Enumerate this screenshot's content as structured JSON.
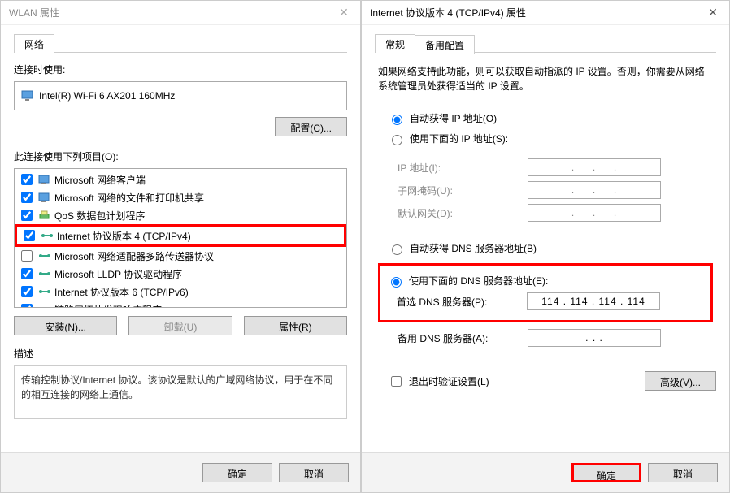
{
  "wlan": {
    "title": "WLAN 属性",
    "tab_network": "网络",
    "connect_using_label": "连接时使用:",
    "adapter": "Intel(R) Wi-Fi 6 AX201 160MHz",
    "configure_btn": "配置(C)...",
    "items_label": "此连接使用下列项目(O):",
    "items": [
      {
        "label": "Microsoft 网络客户端",
        "checked": true,
        "icon": "client"
      },
      {
        "label": "Microsoft 网络的文件和打印机共享",
        "checked": true,
        "icon": "client"
      },
      {
        "label": "QoS 数据包计划程序",
        "checked": true,
        "icon": "qos"
      },
      {
        "label": "Internet 协议版本 4 (TCP/IPv4)",
        "checked": true,
        "icon": "proto",
        "highlight": true
      },
      {
        "label": "Microsoft 网络适配器多路传送器协议",
        "checked": false,
        "icon": "proto"
      },
      {
        "label": "Microsoft LLDP 协议驱动程序",
        "checked": true,
        "icon": "proto"
      },
      {
        "label": "Internet 协议版本 6 (TCP/IPv6)",
        "checked": true,
        "icon": "proto"
      },
      {
        "label": "链路层拓扑发现响应程序",
        "checked": true,
        "icon": "proto"
      }
    ],
    "install_btn": "安装(N)...",
    "uninstall_btn": "卸载(U)",
    "properties_btn": "属性(R)",
    "description_label": "描述",
    "description_text": "传输控制协议/Internet 协议。该协议是默认的广域网络协议，用于在不同的相互连接的网络上通信。",
    "ok_btn": "确定",
    "cancel_btn": "取消"
  },
  "tcpip": {
    "title": "Internet 协议版本 4 (TCP/IPv4) 属性",
    "tab_general": "常规",
    "tab_alt": "备用配置",
    "intro_text": "如果网络支持此功能，则可以获取自动指派的 IP 设置。否则，你需要从网络系统管理员处获得适当的 IP 设置。",
    "radio_ip_auto": "自动获得 IP 地址(O)",
    "radio_ip_manual": "使用下面的 IP 地址(S):",
    "ip_label": "IP 地址(I):",
    "mask_label": "子网掩码(U):",
    "gw_label": "默认网关(D):",
    "radio_dns_auto": "自动获得 DNS 服务器地址(B)",
    "radio_dns_manual": "使用下面的 DNS 服务器地址(E):",
    "dns1_label": "首选 DNS 服务器(P):",
    "dns1_value": "114 . 114 . 114 . 114",
    "dns2_label": "备用 DNS 服务器(A):",
    "dns2_value": ".       .       .",
    "validate_label": "退出时验证设置(L)",
    "advanced_btn": "高级(V)...",
    "ok_btn": "确定",
    "cancel_btn": "取消"
  }
}
